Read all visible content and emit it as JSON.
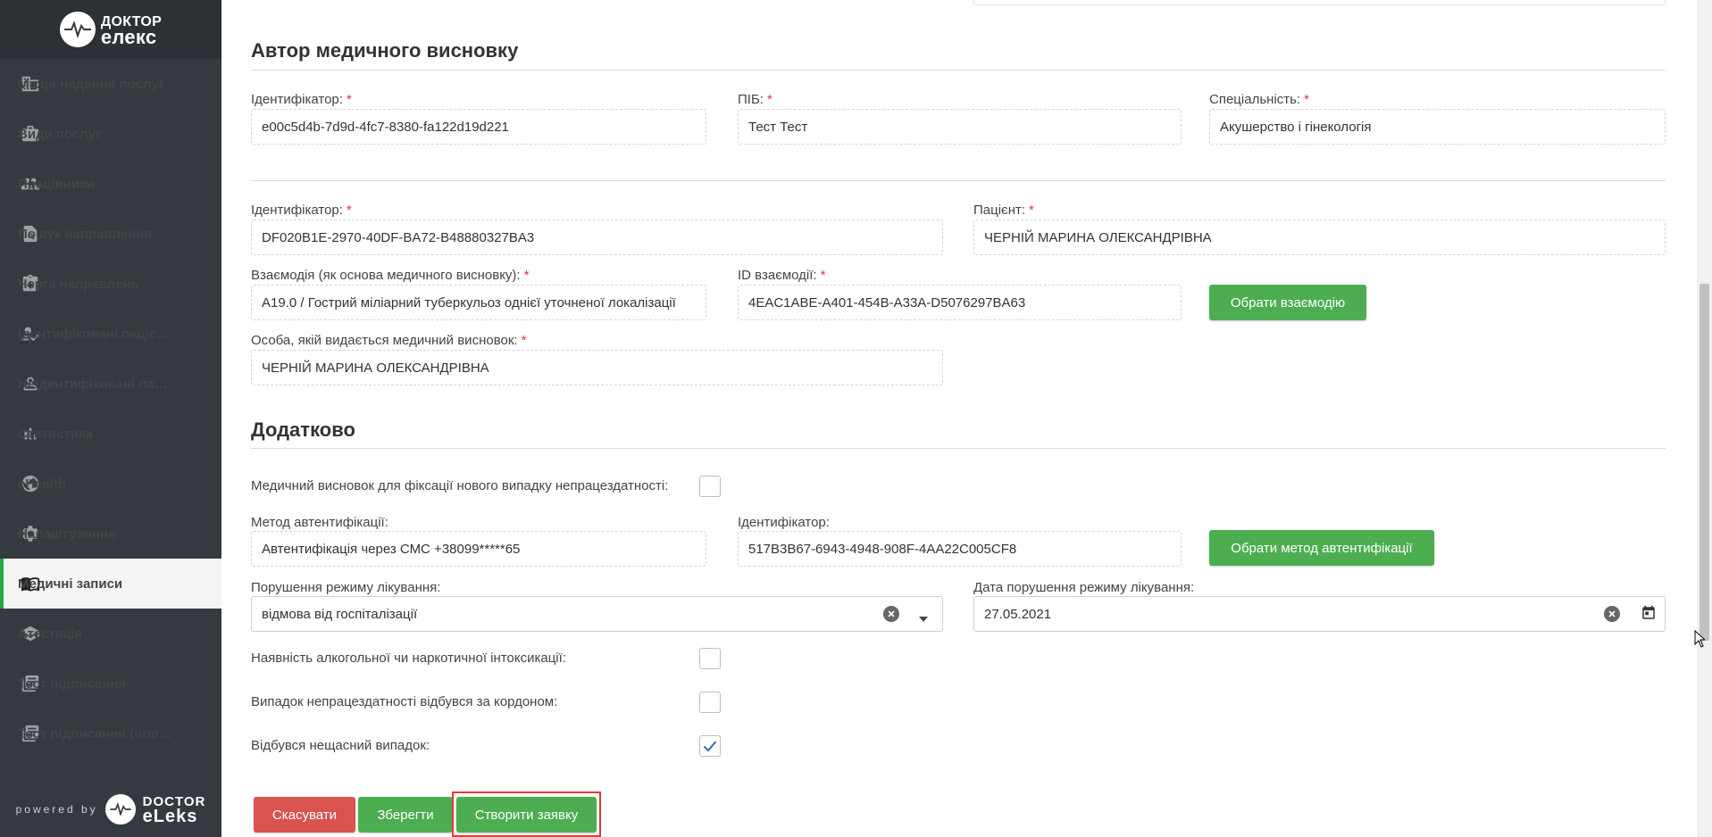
{
  "brand": {
    "top": "ДОКТОР",
    "bottom": "елекс"
  },
  "sidebar": {
    "items": [
      {
        "label": "Місця надання послуг",
        "icon": "building-icon"
      },
      {
        "label": "Види послуг",
        "icon": "briefcase-icon"
      },
      {
        "label": "Працівники",
        "icon": "people-icon"
      },
      {
        "label": "Пошук направлення",
        "icon": "document-search-icon"
      },
      {
        "label": "Черга направлень",
        "icon": "clipboard-icon"
      },
      {
        "label": "Ідентифіковані пацієнти",
        "icon": "user-check-icon"
      },
      {
        "label": "Неідентифіковані пацієнти",
        "icon": "user-outline-icon"
      },
      {
        "label": "Статистика",
        "icon": "bar-chart-icon"
      },
      {
        "label": "eHealth",
        "icon": "globe-icon"
      },
      {
        "label": "Налаштування",
        "icon": "gear-icon"
      },
      {
        "label": "Медичні записи",
        "icon": "book-icon",
        "active": true
      },
      {
        "label": "Атестація",
        "icon": "graduation-cap-icon"
      },
      {
        "label": "Тест підписання",
        "icon": "list-icon"
      },
      {
        "label": "Тест підписання (новий)",
        "icon": "list-icon"
      }
    ],
    "powered_by": "powered by",
    "footer_brand_top": "DOCTOR",
    "footer_brand_bottom": "eLeks"
  },
  "author_section": {
    "title": "Автор медичного висновку",
    "id_label": "Ідентифікатор:",
    "id_value": "e00c5d4b-7d9d-4fc7-8380-fa122d19d221",
    "name_label": "ПІБ:",
    "name_value": "Тест Тест",
    "specialty_label": "Спеціальність:",
    "specialty_value": "Акушерство і гінекологія"
  },
  "record_section": {
    "id_label": "Ідентифікатор:",
    "id_value": "DF020B1E-2970-40DF-BA72-B48880327BA3",
    "patient_label": "Пацієнт:",
    "patient_value": "ЧЕРНІЙ МАРИНА ОЛЕКСАНДРІВНА",
    "interaction_label": "Взаємодія (як основа медичного висновку):",
    "interaction_value": "A19.0 / Гострий міліарний туберкульоз однієї уточненої локалізації",
    "interaction_id_label": "ID взаємодії:",
    "interaction_id_value": "4EAC1ABE-A401-454B-A33A-D5076297BA63",
    "choose_interaction_button": "Обрати взаємодію",
    "person_label": "Особа, якій видається медичний висновок:",
    "person_value": "ЧЕРНІЙ МАРИНА ОЛЕКСАНДРІВНА"
  },
  "additional_section": {
    "title": "Додатково",
    "new_case_label": "Медичний висновок для фіксації нового випадку непрацездатності:",
    "new_case_checked": false,
    "auth_method_label": "Метод автентифікації:",
    "auth_method_value": "Автентифікація через СМС +38099*****65",
    "auth_id_label": "Ідентифікатор:",
    "auth_id_value": "517B3B67-6943-4948-908F-4AA22C005CF8",
    "choose_auth_button": "Обрати метод автентифікації",
    "violation_label": "Порушення режиму лікування:",
    "violation_value": "відмова від госпіталізації",
    "violation_date_label": "Дата порушення режиму лікування:",
    "violation_date_value": "27.05.2021",
    "intoxication_label": "Наявність алкогольної чи наркотичної інтоксикації:",
    "intoxication_checked": false,
    "abroad_label": "Випадок непрацездатності відбувся за кордоном:",
    "abroad_checked": false,
    "accident_label": "Відбувся нещасний випадок:",
    "accident_checked": true
  },
  "actions": {
    "cancel": "Скасувати",
    "save": "Зберегти",
    "create_request": "Створити заявку"
  },
  "colors": {
    "sidebar_bg": "#343a40",
    "accent_green": "#4cae50",
    "danger_red": "#d9534f",
    "required_star": "#e53935"
  }
}
